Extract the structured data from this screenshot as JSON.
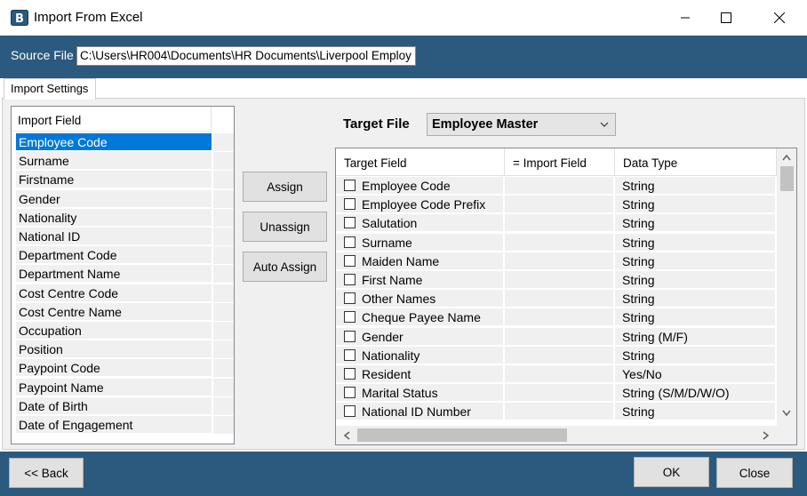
{
  "window": {
    "title": "Import From Excel"
  },
  "source": {
    "label": "Source File",
    "value": "C:\\Users\\HR004\\Documents\\HR Documents\\Liverpool Employ"
  },
  "tabs": [
    {
      "label": "Import Settings"
    }
  ],
  "import_list": {
    "header": "Import Field",
    "items": [
      "Employee Code",
      "Surname",
      "Firstname",
      "Gender",
      "Nationality",
      "National ID",
      "Department Code",
      "Department Name",
      "Cost Centre Code",
      "Cost Centre Name",
      "Occupation",
      "Position",
      "Paypoint Code",
      "Paypoint Name",
      "Date of Birth",
      "Date of Engagement"
    ],
    "selected_index": 0
  },
  "actions": {
    "assign": "Assign",
    "unassign": "Unassign",
    "auto_assign": "Auto Assign"
  },
  "target": {
    "label": "Target File",
    "selected": "Employee Master"
  },
  "grid": {
    "columns": [
      "Target Field",
      "= Import Field",
      "Data Type"
    ],
    "rows": [
      {
        "field": "Employee Code",
        "import": "",
        "type": "String"
      },
      {
        "field": "Employee Code Prefix",
        "import": "",
        "type": "String"
      },
      {
        "field": "Salutation",
        "import": "",
        "type": "String"
      },
      {
        "field": "Surname",
        "import": "",
        "type": "String"
      },
      {
        "field": "Maiden Name",
        "import": "",
        "type": "String"
      },
      {
        "field": "First Name",
        "import": "",
        "type": "String"
      },
      {
        "field": "Other Names",
        "import": "",
        "type": "String"
      },
      {
        "field": "Cheque Payee Name",
        "import": "",
        "type": "String"
      },
      {
        "field": "Gender",
        "import": "",
        "type": "String (M/F)"
      },
      {
        "field": "Nationality",
        "import": "",
        "type": "String"
      },
      {
        "field": "Resident",
        "import": "",
        "type": "Yes/No"
      },
      {
        "field": "Marital Status",
        "import": "",
        "type": "String  (S/M/D/W/O)"
      },
      {
        "field": "National ID Number",
        "import": "",
        "type": "String"
      }
    ]
  },
  "footer": {
    "back": "<< Back",
    "ok": "OK",
    "close": "Close"
  },
  "colors": {
    "band": "#2b5a7e",
    "selection": "#0078d7"
  }
}
